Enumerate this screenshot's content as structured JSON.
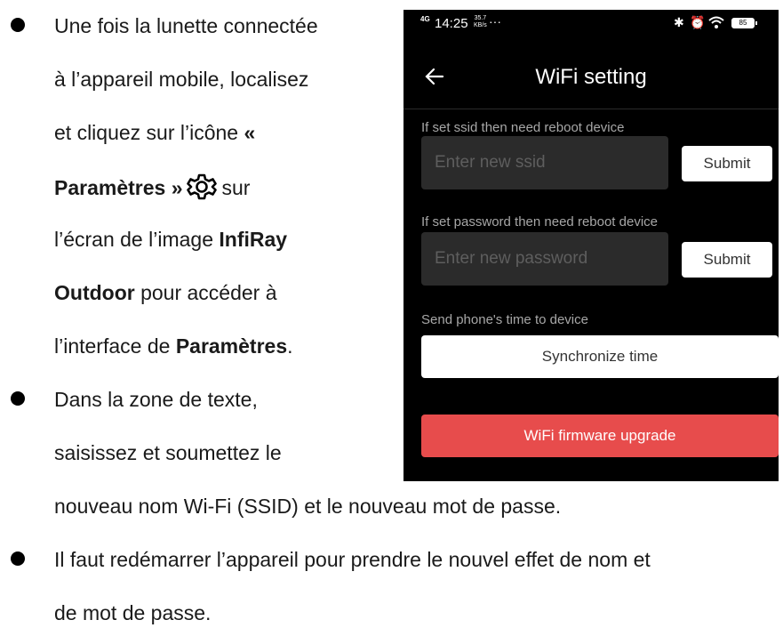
{
  "instructions": {
    "bullet1": {
      "line1": "Une fois la lunette connectée",
      "line2": "à l’appareil mobile, localisez",
      "line3_before": "et cliquez sur l’icône ",
      "line3_bold": "«",
      "line4_bold": "Paramètres »",
      "line4_after": "sur",
      "line5_before": "l’écran de l’image ",
      "line5_bold": "InfiRay",
      "line6_bold": "Outdoor",
      "line6_after": " pour accéder à",
      "line7_before": "l’interface de ",
      "line7_bold": "Paramètres",
      "line7_after": "."
    },
    "bullet2": {
      "line1": "Dans la zone de texte,",
      "line2": "saisissez et soumettez le",
      "line3": "nouveau nom Wi-Fi (SSID) et le nouveau mot de passe."
    },
    "bullet3": {
      "line1": "Il faut redémarrer l’appareil pour prendre le nouvel effet de nom et",
      "line2": "de mot de passe."
    }
  },
  "phone": {
    "status_bar": {
      "network": "4G",
      "time": "14:25",
      "speed_value": "35.7",
      "speed_unit": "KB/s",
      "dots": "···",
      "battery": "85"
    },
    "title": "WiFi setting",
    "ssid_hint": "If set ssid then need reboot device",
    "ssid_placeholder": "Enter new ssid",
    "ssid_submit": "Submit",
    "password_hint": "If set password then need reboot device",
    "password_placeholder": "Enter new password",
    "password_submit": "Submit",
    "time_hint": "Send phone's time to device",
    "sync_button": "Synchronize time",
    "upgrade_button": "WiFi firmware upgrade",
    "colors": {
      "background": "#000000",
      "upgrade": "#e74c4c",
      "input": "#2b2b2b"
    }
  }
}
